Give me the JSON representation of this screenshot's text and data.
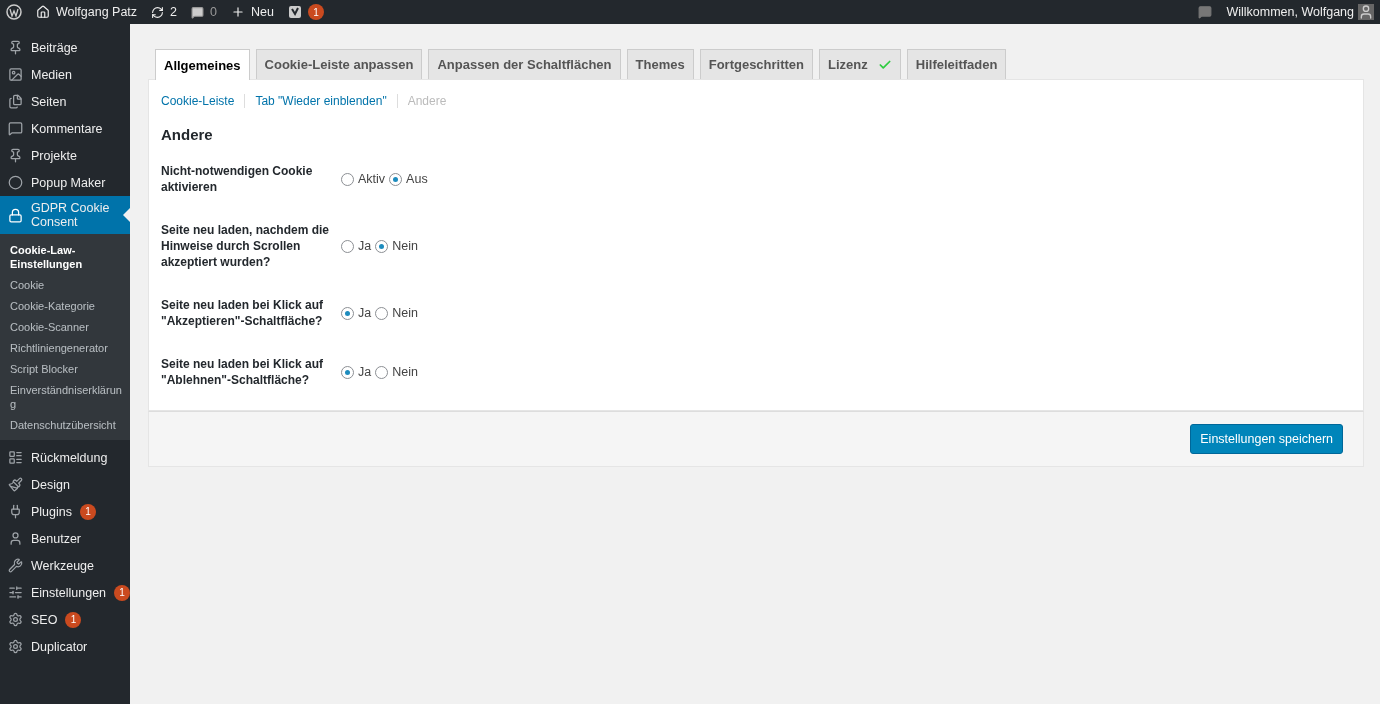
{
  "admin_bar": {
    "site": "Wolfgang Patz",
    "updates": "2",
    "comments": "0",
    "new": "Neu",
    "seo_badge": "1",
    "greeting": "Willkommen, Wolfgang"
  },
  "sidebar": {
    "items": [
      {
        "label": "Beiträge",
        "selected": false
      },
      {
        "label": "Medien",
        "selected": false
      },
      {
        "label": "Seiten",
        "selected": false
      },
      {
        "label": "Kommentare",
        "selected": false
      },
      {
        "label": "Projekte",
        "selected": false
      },
      {
        "label": "Popup Maker",
        "selected": false
      },
      {
        "label": "GDPR Cookie Consent",
        "selected": true,
        "children": [
          {
            "label": "Cookie-Law-Einstellungen",
            "selected": true
          },
          {
            "label": "Cookie",
            "selected": false
          },
          {
            "label": "Cookie-Kategorie",
            "selected": false
          },
          {
            "label": "Cookie-Scanner",
            "selected": false
          },
          {
            "label": "Richtliniengenerator",
            "selected": false
          },
          {
            "label": "Script Blocker",
            "selected": false
          },
          {
            "label": "Einverständniserklärung",
            "selected": false
          },
          {
            "label": "Datenschutzübersicht",
            "selected": false
          }
        ]
      },
      {
        "label": "Rückmeldung",
        "selected": false
      },
      {
        "label": "Design",
        "selected": false
      },
      {
        "label": "Plugins",
        "selected": false,
        "badge": "1"
      },
      {
        "label": "Benutzer",
        "selected": false
      },
      {
        "label": "Werkzeuge",
        "selected": false
      },
      {
        "label": "Einstellungen",
        "selected": false,
        "badge": "1"
      },
      {
        "label": "SEO",
        "selected": false,
        "badge": "1"
      },
      {
        "label": "Duplicator",
        "selected": false
      }
    ]
  },
  "tabs": [
    {
      "label": "Allgemeines",
      "selected": true
    },
    {
      "label": "Cookie-Leiste anpassen",
      "selected": false
    },
    {
      "label": "Anpassen der Schaltflächen",
      "selected": false
    },
    {
      "label": "Themes",
      "selected": false
    },
    {
      "label": "Fortgeschritten",
      "selected": false
    },
    {
      "label": "Lizenz",
      "selected": false,
      "checked": true
    },
    {
      "label": "Hilfeleitfaden",
      "selected": false
    }
  ],
  "subnav": [
    {
      "label": "Cookie-Leiste",
      "selected": false
    },
    {
      "label": "Tab \"Wieder einblenden\"",
      "selected": false
    },
    {
      "label": "Andere",
      "selected": true
    }
  ],
  "section_title": "Andere",
  "settings": [
    {
      "label": "Nicht-notwendigen Cookie aktivieren",
      "options": [
        {
          "label": "Aktiv",
          "selected": false
        },
        {
          "label": "Aus",
          "selected": true
        }
      ]
    },
    {
      "label": "Seite neu laden, nachdem die Hinweise durch Scrollen akzeptiert wurden?",
      "options": [
        {
          "label": "Ja",
          "selected": false
        },
        {
          "label": "Nein",
          "selected": true
        }
      ]
    },
    {
      "label": "Seite neu laden bei Klick auf \"Akzeptieren\"-Schaltfläche?",
      "options": [
        {
          "label": "Ja",
          "selected": true
        },
        {
          "label": "Nein",
          "selected": false
        }
      ]
    },
    {
      "label": "Seite neu laden bei Klick auf \"Ablehnen\"-Schaltfläche?",
      "options": [
        {
          "label": "Ja",
          "selected": true
        },
        {
          "label": "Nein",
          "selected": false
        }
      ]
    }
  ],
  "save_button": "Einstellungen speichern"
}
